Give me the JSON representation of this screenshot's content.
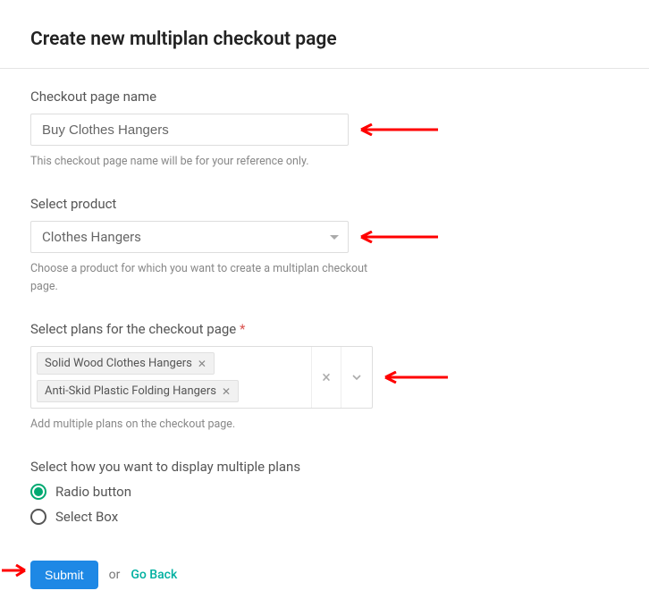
{
  "page": {
    "title": "Create new multiplan checkout page"
  },
  "fields": {
    "name": {
      "label": "Checkout page name",
      "value": "Buy Clothes Hangers",
      "helper": "This checkout page name will be for your reference only."
    },
    "product": {
      "label": "Select product",
      "selected": "Clothes Hangers",
      "helper": "Choose a product for which you want to create a multiplan checkout page."
    },
    "plans": {
      "label": "Select plans for the checkout page",
      "required_mark": "*",
      "tags": [
        "Solid Wood Clothes Hangers",
        "Anti-Skid Plastic Folding Hangers"
      ],
      "helper": "Add multiple plans on the checkout page."
    },
    "display": {
      "label": "Select how you want to display multiple plans",
      "options": [
        {
          "label": "Radio button",
          "checked": true
        },
        {
          "label": "Select Box",
          "checked": false
        }
      ]
    }
  },
  "actions": {
    "submit": "Submit",
    "or": "or",
    "go_back": "Go Back"
  },
  "annotations": {
    "arrow_color": "#ff0000"
  }
}
